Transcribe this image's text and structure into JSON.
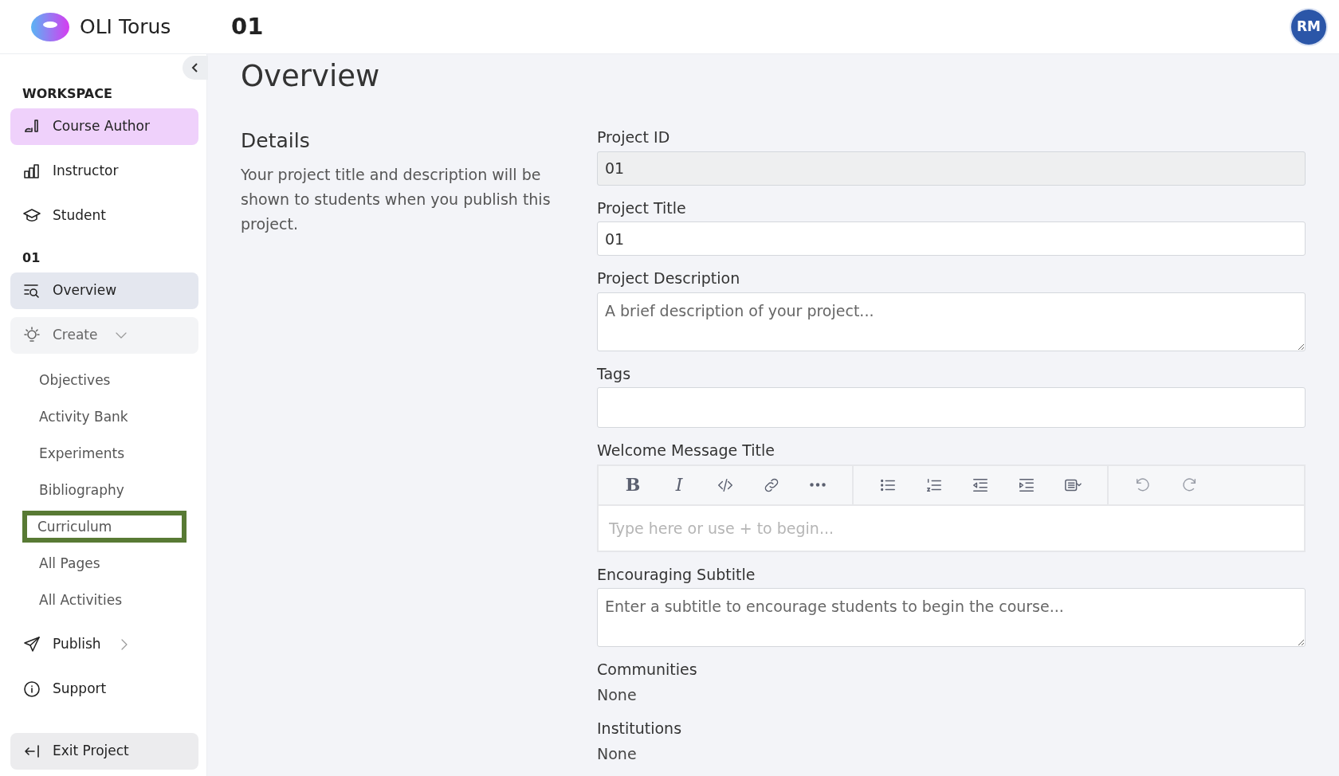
{
  "header": {
    "brand": "OLI Torus",
    "project": "01",
    "avatar": "RM"
  },
  "sidebar": {
    "workspace_title": "WORKSPACE",
    "workspace_items": [
      {
        "label": "Course Author",
        "selected": true
      },
      {
        "label": "Instructor",
        "selected": false
      },
      {
        "label": "Student",
        "selected": false
      }
    ],
    "project_title": "01",
    "project_items": [
      {
        "label": "Overview",
        "selected": true,
        "kind": "link"
      },
      {
        "label": "Create",
        "selected": false,
        "kind": "group",
        "expanded": true,
        "children": [
          {
            "label": "Objectives",
            "highlighted": false
          },
          {
            "label": "Activity Bank",
            "highlighted": false
          },
          {
            "label": "Experiments",
            "highlighted": false
          },
          {
            "label": "Bibliography",
            "highlighted": false
          },
          {
            "label": "Curriculum",
            "highlighted": true
          },
          {
            "label": "All Pages",
            "highlighted": false
          },
          {
            "label": "All Activities",
            "highlighted": false
          }
        ]
      },
      {
        "label": "Publish",
        "selected": false,
        "kind": "group",
        "expanded": false
      },
      {
        "label": "Support",
        "selected": false,
        "kind": "link"
      }
    ],
    "exit": "Exit Project"
  },
  "page": {
    "title": "Overview",
    "section_title": "Details",
    "section_text": "Your project title and description will be shown to students when you publish this project.",
    "fields": [
      {
        "label": "Project ID",
        "kind": "input",
        "value": "01",
        "disabled": true
      },
      {
        "label": "Project Title",
        "kind": "input",
        "value": "01",
        "disabled": false
      },
      {
        "label": "Project Description",
        "kind": "textarea",
        "placeholder": "A brief description of your project..."
      },
      {
        "label": "Tags",
        "kind": "tags"
      },
      {
        "label": "Welcome Message Title",
        "kind": "editor",
        "placeholder": "Type here or use + to begin...",
        "bold_label": "B",
        "italic_label": "I"
      },
      {
        "label": "Encouraging Subtitle",
        "kind": "textarea",
        "placeholder": "Enter a subtitle to encourage students to begin the course..."
      },
      {
        "label": "Communities",
        "kind": "readonly",
        "value": "None"
      },
      {
        "label": "Institutions",
        "kind": "readonly",
        "value": "None"
      }
    ]
  }
}
